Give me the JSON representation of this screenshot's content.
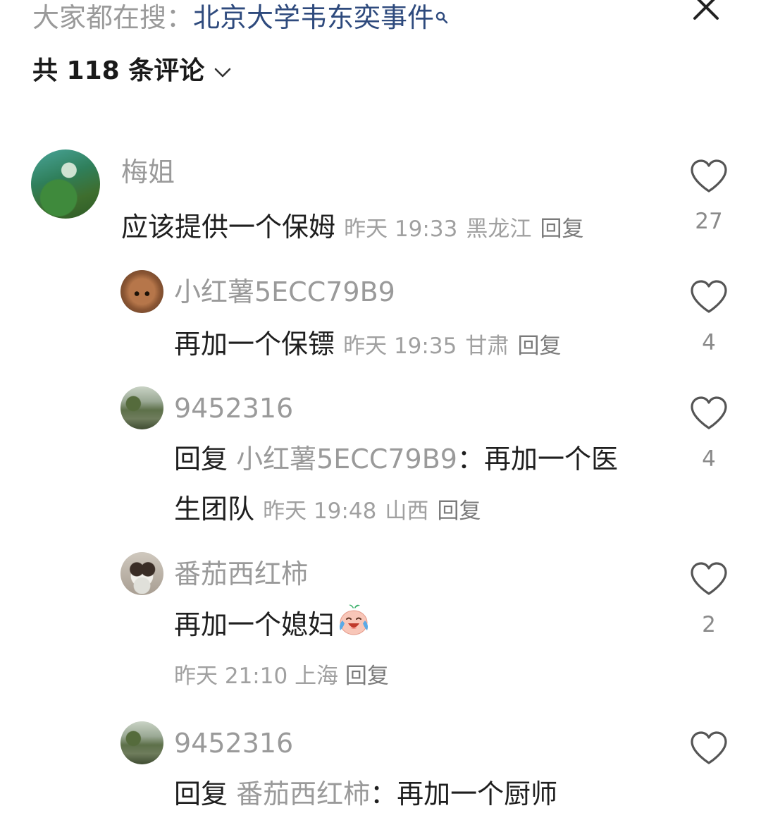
{
  "search": {
    "prefix": "大家都在搜：",
    "keyword": "北京大学韦东奕事件"
  },
  "header": {
    "comment_count_label": "共 118 条评论"
  },
  "comments": [
    {
      "username": "梅姐",
      "text": "应该提供一个保姆",
      "time": "昨天 19:33",
      "location": "黑龙江",
      "reply_label": "回复",
      "likes": "27"
    }
  ],
  "replies": [
    {
      "username": "小红薯5ECC79B9",
      "text": "再加一个保镖",
      "time": "昨天 19:35",
      "location": "甘肃",
      "reply_label": "回复",
      "likes": "4"
    },
    {
      "username": "9452316",
      "reply_prefix": "回复",
      "reply_to": "小红薯5ECC79B9",
      "text_line1": "：再加一个医",
      "text_line2": "生团队",
      "time": "昨天 19:48",
      "location": "山西",
      "reply_label": "回复",
      "likes": "4"
    },
    {
      "username": "番茄西红柿",
      "text": "再加一个媳妇",
      "emoji": "crying-laughing-emoji",
      "time": "昨天 21:10",
      "location": "上海",
      "reply_label": "回复",
      "likes": "2"
    },
    {
      "username": "9452316",
      "reply_prefix": "回复",
      "reply_to": "番茄西红柿",
      "text": "：再加一个厨师"
    }
  ],
  "icons": {
    "close": "close-icon",
    "chevron": "chevron-down-icon",
    "like": "heart-outline-icon",
    "search_mag": "search-icon"
  },
  "colors": {
    "keyword": "#2e4a7d",
    "secondary_text": "#9a9a9a",
    "primary_text": "#1f1f1f",
    "heart_outline": "#555555"
  }
}
